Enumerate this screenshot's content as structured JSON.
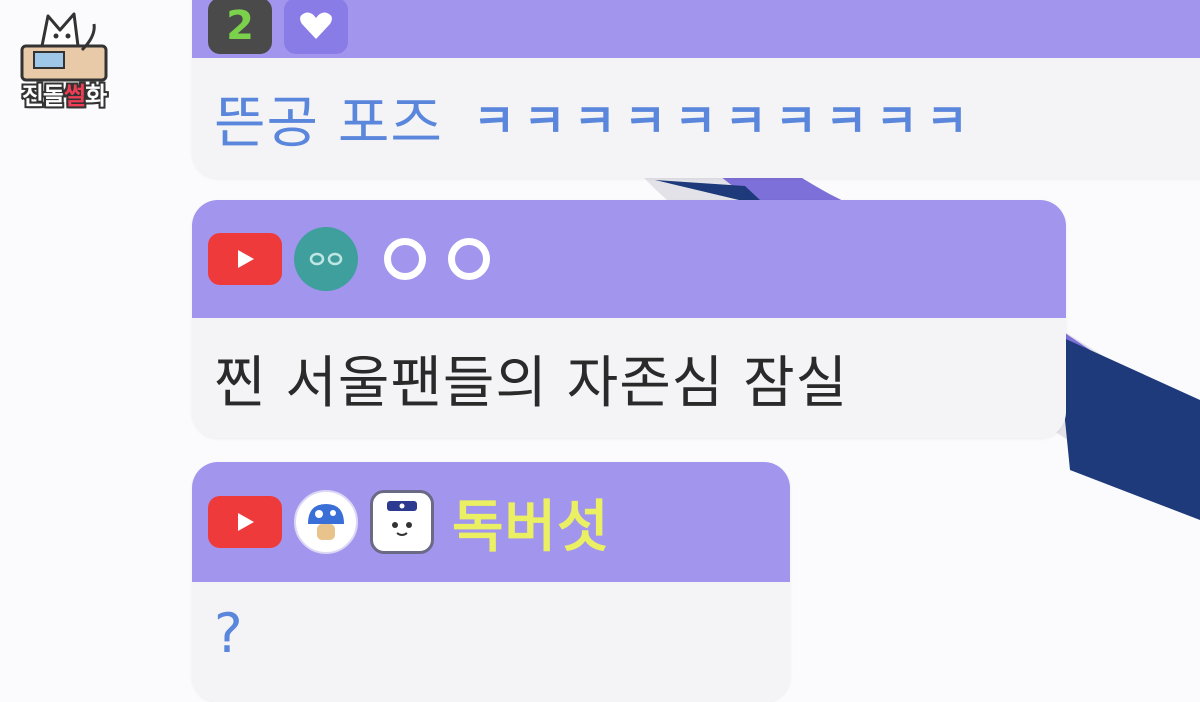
{
  "watermark": {
    "brand_pre": "진돌",
    "brand_accent": "썰",
    "brand_post": "화",
    "accent_color": "#ee3d54"
  },
  "colors": {
    "header_purple": "#a195ee",
    "body_gray": "#f4f4f7",
    "username_yellow": "#eaf062",
    "message_blue": "#5a86dc",
    "message_dark": "#2a2a2a",
    "youtube_red": "#ee3a3a"
  },
  "chat": {
    "messages": [
      {
        "badges": [
          "number-badge",
          "heart-badge"
        ],
        "badge_number": "2",
        "username": "",
        "text": "뜬공 포즈",
        "laugh": "ㅋㅋㅋㅋㅋㅋㅋㅋㅋㅋ"
      },
      {
        "badges": [
          "youtube-icon",
          "teal-eyes-avatar"
        ],
        "username": "ㅇㅇ",
        "text": "찐 서울팬들의 자존심 잠실"
      },
      {
        "badges": [
          "youtube-icon",
          "mushroom-avatar",
          "cat-avatar"
        ],
        "username": "독버섯",
        "text": "?"
      }
    ]
  }
}
